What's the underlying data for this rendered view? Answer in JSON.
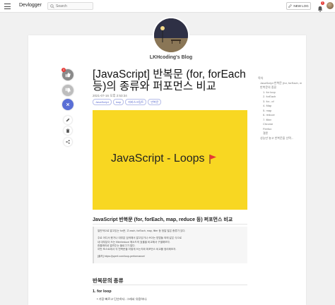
{
  "topbar": {
    "brand": "Devlogger",
    "search_placeholder": "Search",
    "new_log_label": "NEW LOG",
    "notification_count": "1"
  },
  "blog": {
    "name": "LKHcoding's Blog"
  },
  "post": {
    "title_line1": "[JavaScript] 반복문 (for, forEach",
    "title_line2": "등)의 종류와 퍼포먼스 비교",
    "date": "2021-07-16 오후 2:53:34",
    "tags": [
      "JavaScript",
      "loop",
      "자바스크립트",
      "반복문"
    ],
    "hero_text": "JavaScript - Loops",
    "subtitle": "JavaScript 반복문 (for, forEach, map, reduce 등) 퍼포먼스 비교",
    "quote_lines": [
      "일반적으로 알고있는 for문, 고.each, forEach, map, filter 등 정말 많은 종류가 있다.",
      "",
      "주로 어디서 봤거나 대부분 검색해서 알고있거나 쓰이는 방법들 외에 같은 식으로",
      "내 대부분이 쓰는 filter/reduce 메소드의 효율을 비교해서 구별해보자.",
      "한줄짜리로 알려주는 블로그가 많다.",
      "이번 포스트에서 각 반복문을 어떻게 쓰는지와 퍼포먼스 비교를 정리해보자.",
      "",
      "[출처] https://jsperf.com/loop-performance/"
    ],
    "section_heading": "반복문의 종류",
    "item_heading": "1. for loop",
    "bullet": "가장 빠르고 단순하다. 그래서 유용하다."
  },
  "actions": {
    "like_count": "3"
  },
  "toc": [
    {
      "level": 0,
      "text": "목차"
    },
    {
      "level": 1,
      "text": "JavaScript 반복문 (for, forEach, map...)"
    },
    {
      "level": 1,
      "text": "반복문의 종류"
    },
    {
      "level": 2,
      "text": "1. for loop"
    },
    {
      "level": 2,
      "text": "2. forEach"
    },
    {
      "level": 2,
      "text": "3. for...of"
    },
    {
      "level": 2,
      "text": "4. Map"
    },
    {
      "level": 2,
      "text": "5. map"
    },
    {
      "level": 2,
      "text": "6. reduce"
    },
    {
      "level": 2,
      "text": "7. filter"
    },
    {
      "level": 2,
      "text": "Chrome"
    },
    {
      "level": 2,
      "text": "Firefox"
    },
    {
      "level": 2,
      "text": "결론"
    },
    {
      "level": 1,
      "text": "성능만 놓고 반복문을 선택..."
    }
  ],
  "colors": {
    "hero_bg": "#f8d722",
    "tag_text": "#5b6ad0",
    "action_blue": "#5a6fd6",
    "badge_red": "#e53935"
  }
}
